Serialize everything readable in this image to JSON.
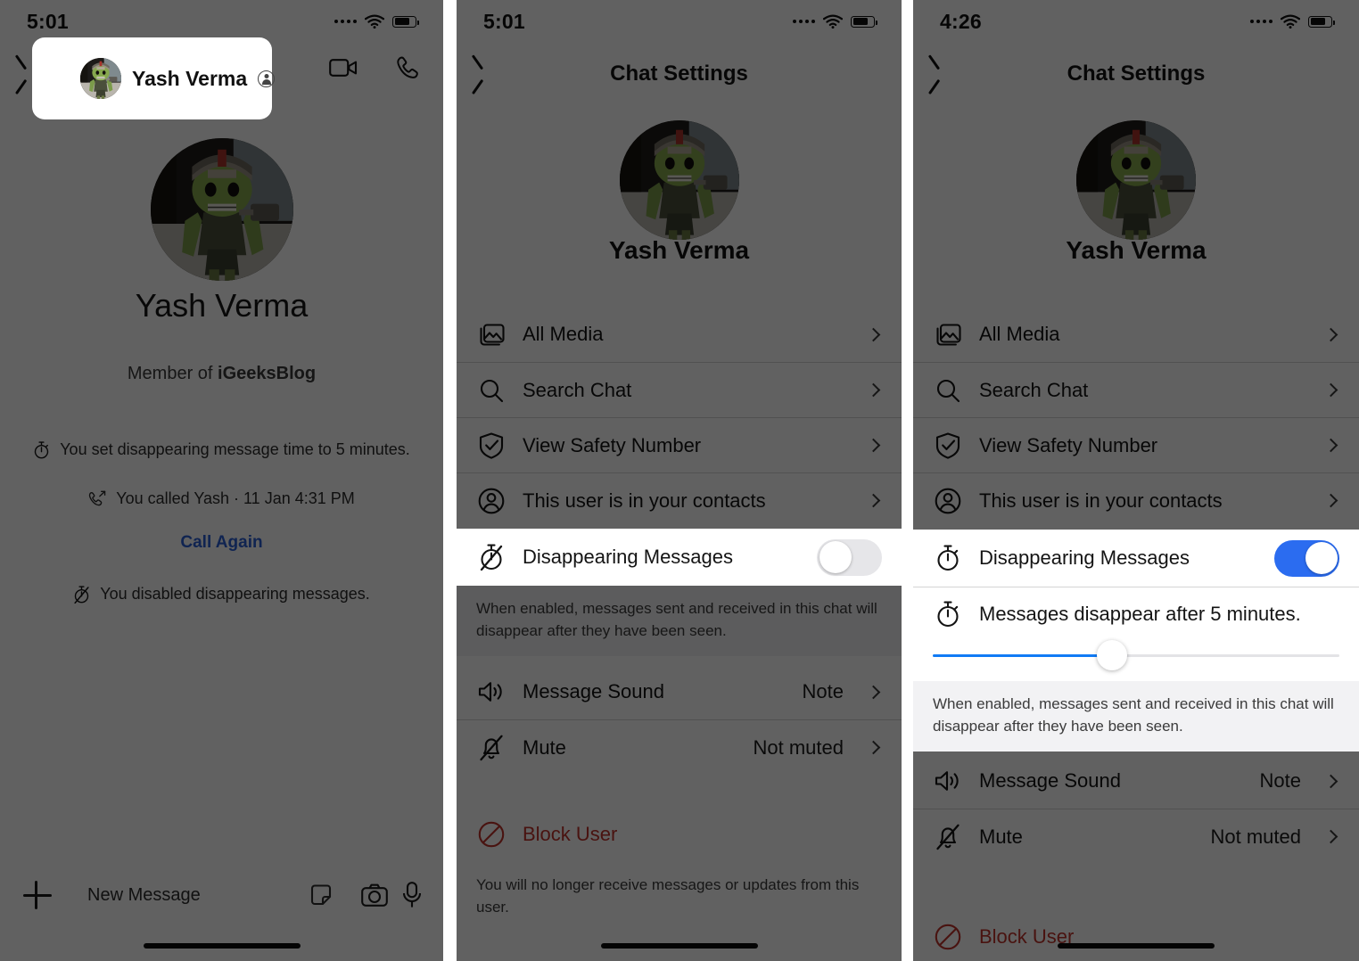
{
  "meta": {
    "app": "Signal",
    "screens": 3
  },
  "colors": {
    "accent_blue": "#2b6cf0",
    "slider_blue": "#117bf5",
    "danger_red": "#c0322b",
    "link_blue": "#2a5fd4",
    "dim_overlay": "rgba(0,0,0,0.62)"
  },
  "panel1": {
    "status": {
      "time": "5:01",
      "wifi": "wifi-icon",
      "battery": "battery-icon",
      "signal": "signal-dots-icon"
    },
    "header": {
      "back": "back-chevron-icon",
      "avatar": "contact-avatar",
      "name": "Yash Verma",
      "verified_badge": "contact-badge-icon",
      "video_call": "video-camera-icon",
      "voice_call": "phone-icon"
    },
    "profile": {
      "name": "Yash Verma",
      "member_prefix": "Member of ",
      "member_group": "iGeeksBlog"
    },
    "system_messages": [
      {
        "icon": "stopwatch-icon",
        "text": "You set disappearing message time to 5 minutes."
      },
      {
        "icon": "outgoing-call-icon",
        "text": "You called Yash · 11 Jan 4:31 PM"
      },
      {
        "icon": "stopwatch-off-icon",
        "text": "You disabled disappearing messages."
      }
    ],
    "call_again": "Call Again",
    "composer": {
      "add": "plus-icon",
      "placeholder": "New Message",
      "sticker": "sticker-icon",
      "camera": "camera-icon",
      "mic": "microphone-icon"
    }
  },
  "panel2": {
    "status": {
      "time": "5:01"
    },
    "nav": {
      "back": "back-chevron-icon",
      "title": "Chat Settings"
    },
    "profile": {
      "name": "Yash Verma"
    },
    "menu": [
      {
        "icon": "photos-icon",
        "label": "All Media"
      },
      {
        "icon": "search-icon",
        "label": "Search Chat"
      },
      {
        "icon": "shield-check-icon",
        "label": "View Safety Number"
      },
      {
        "icon": "person-circle-icon",
        "label": "This user is in your contacts"
      }
    ],
    "disappearing": {
      "icon": "stopwatch-off-icon",
      "label": "Disappearing Messages",
      "toggle_state": "off",
      "footnote": "When enabled, messages sent and received in this chat will disappear after they have been seen."
    },
    "notifications": [
      {
        "icon": "speaker-icon",
        "label": "Message Sound",
        "value": "Note"
      },
      {
        "icon": "bell-slash-icon",
        "label": "Mute",
        "value": "Not muted"
      }
    ],
    "block": {
      "icon": "block-icon",
      "label": "Block User",
      "footnote": "You will no longer receive messages or updates from this user."
    }
  },
  "panel3": {
    "status": {
      "time": "4:26"
    },
    "nav": {
      "back": "back-chevron-icon",
      "title": "Chat Settings"
    },
    "profile": {
      "name": "Yash Verma"
    },
    "menu": [
      {
        "icon": "photos-icon",
        "label": "All Media"
      },
      {
        "icon": "search-icon",
        "label": "Search Chat"
      },
      {
        "icon": "shield-check-icon",
        "label": "View Safety Number"
      },
      {
        "icon": "person-circle-icon",
        "label": "This user is in your contacts"
      }
    ],
    "disappearing": {
      "icon": "stopwatch-icon",
      "label": "Disappearing Messages",
      "toggle_state": "on",
      "timer_icon": "stopwatch-icon",
      "timer_label": "Messages disappear after 5 minutes.",
      "slider_percent": 44,
      "footnote": "When enabled, messages sent and received in this chat will disappear after they have been seen."
    },
    "notifications": [
      {
        "icon": "speaker-icon",
        "label": "Message Sound",
        "value": "Note"
      },
      {
        "icon": "bell-slash-icon",
        "label": "Mute",
        "value": "Not muted"
      }
    ],
    "block": {
      "icon": "block-icon",
      "label": "Block User"
    }
  }
}
